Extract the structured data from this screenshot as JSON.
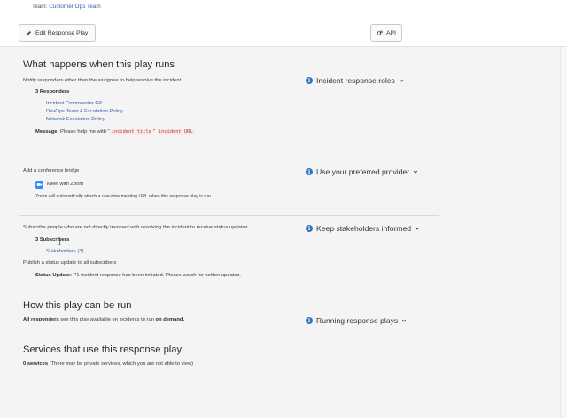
{
  "header": {
    "team_label": "Team:",
    "team_name": "Customer Ops Team"
  },
  "toolbar": {
    "edit_label": "Edit Response Play",
    "api_label": "API"
  },
  "section_run": {
    "title": "What happens when this play runs",
    "notify_text": "Notify responders other than the assignee to help resolve the incident",
    "responders_count": "3 Responders",
    "responders": [
      "Incident Commander EP",
      "DevOps Team A Escalation Policy",
      "Network Escalation Policy"
    ],
    "message_label": "Message:",
    "message_text": "Please help me with \"",
    "message_code1": "incident title",
    "message_mid": "\"",
    "message_code2": "incident URL",
    "side_label": "Incident response roles"
  },
  "section_conference": {
    "text": "Add a conference bridge",
    "zoom_label": "Meet with Zoom",
    "zoom_note": "Zoom will automatically attach a one-time meeting URL when this response play is run.",
    "side_label": "Use your preferred provider"
  },
  "section_subscribers": {
    "text": "Subscribe people who are not directly involved with resolving the incident to receive status updates",
    "subscribers_count": "3 Subscribers",
    "stakeholders_link": "Stakeholders (3)",
    "publish_text": "Publish a status update to all subscribers",
    "status_label": "Status Update:",
    "status_text": "P1 incident response has been initiated. Please watch for further updates.",
    "side_label": "Keep stakeholders informed"
  },
  "section_how": {
    "title": "How this play can be run",
    "all_responders": "All responders",
    "text_mid": "see this play available on incidents to run",
    "on_demand": "on demand.",
    "side_label": "Running response plays"
  },
  "section_services": {
    "title": "Services that use this response play",
    "count": "0 services",
    "note": "(There may be private services, which you are not able to view)"
  },
  "colors": {
    "accent": "#2f76c4",
    "link": "#3b5fa8",
    "zoom": "#2d8cff",
    "code_text": "#b23b3b"
  }
}
